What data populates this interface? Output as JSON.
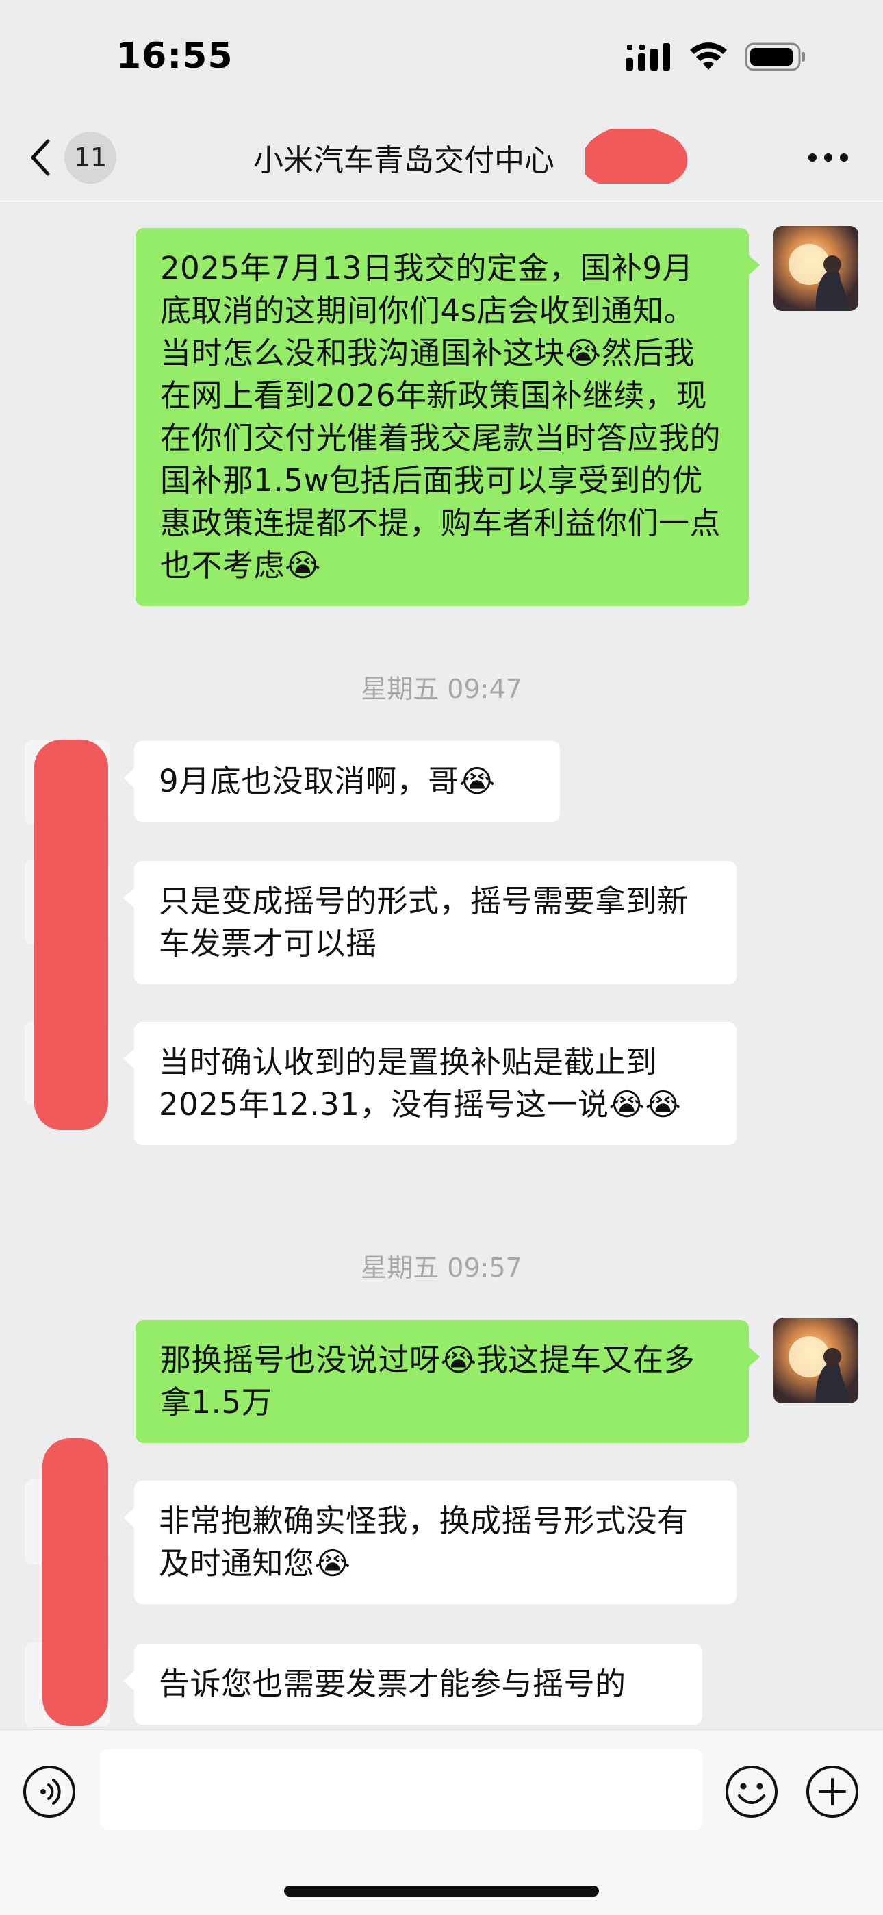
{
  "status_bar": {
    "time": "16:55"
  },
  "nav": {
    "unread_count": "11",
    "title": "小米汽车青岛交付中心",
    "back_icon": "chevron-left-icon",
    "more_icon": "more-horizontal-icon"
  },
  "messages": [
    {
      "direction": "out",
      "text": "2025年7月13日我交的定金，国补9月底取消的这期间你们4s店会收到通知。当时怎么没和我沟通国补这块😭然后我在网上看到2026年新政策国补继续，现在你们交付光催着我交尾款当时答应我的国补那1.5w包括后面我可以享受到的优惠政策连提都不提，购车者利益你们一点也不考虑😭"
    },
    {
      "direction": "in",
      "text": "9月底也没取消啊，哥😭"
    },
    {
      "direction": "in",
      "text": "只是变成摇号的形式，摇号需要拿到新车发票才可以摇"
    },
    {
      "direction": "in",
      "text": "当时确认收到的是置换补贴是截止到2025年12.31，没有摇号这一说😭😭"
    },
    {
      "direction": "out",
      "text": "那换摇号也没说过呀😭我这提车又在多拿1.5万"
    },
    {
      "direction": "in",
      "text": "非常抱歉确实怪我，换成摇号形式没有及时通知您😭"
    },
    {
      "direction": "in",
      "text": "告诉您也需要发票才能参与摇号的"
    }
  ],
  "timestamps": [
    "星期五 09:47",
    "星期五 09:57"
  ],
  "input_bar": {
    "placeholder": "",
    "voice_icon": "voice-icon",
    "emoji_icon": "emoji-icon",
    "plus_icon": "plus-icon"
  },
  "colors": {
    "outgoing_bubble": "#95ec69",
    "incoming_bubble": "#ffffff",
    "background": "#ededed",
    "redaction": "#f05a5a"
  }
}
